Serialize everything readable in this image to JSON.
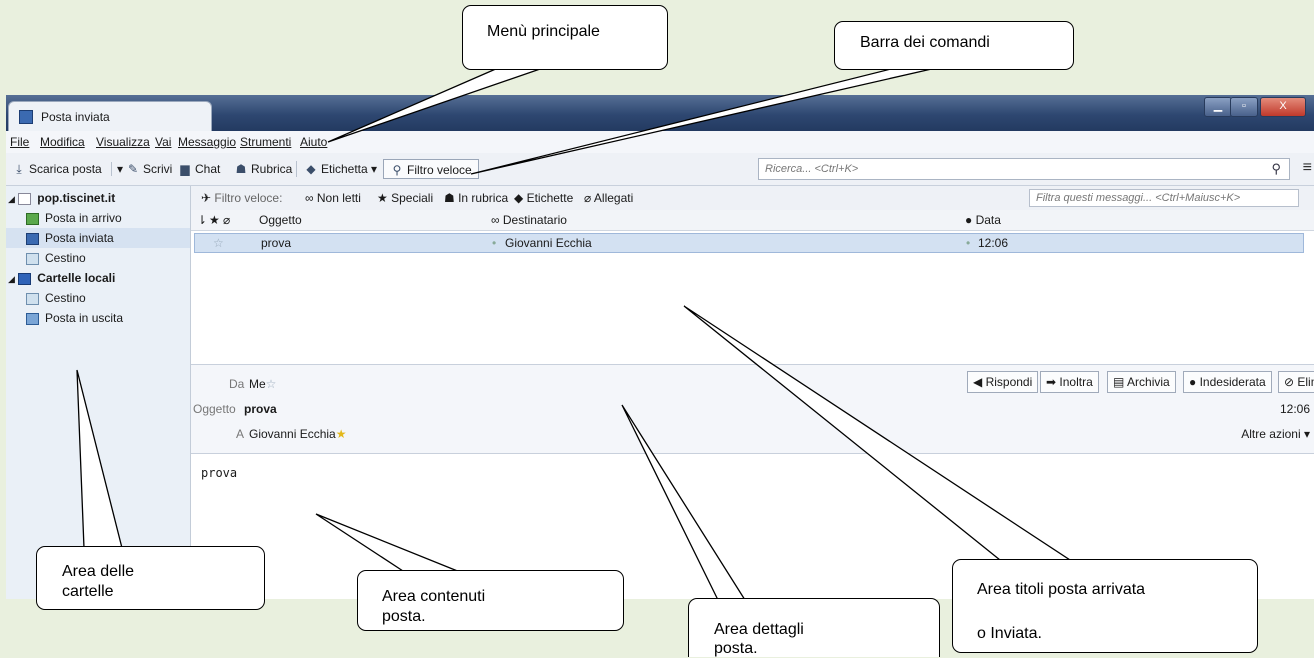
{
  "window": {
    "tab_title": "Posta inviata",
    "controls": {
      "minimize": "▁",
      "maximize": "▫",
      "close": "X"
    }
  },
  "menubar": [
    {
      "label": "File"
    },
    {
      "label": "Modifica"
    },
    {
      "label": "Visualizza"
    },
    {
      "label": "Vai"
    },
    {
      "label": "Messaggio"
    },
    {
      "label": "Strumenti"
    },
    {
      "label": "Aiuto"
    }
  ],
  "toolbar": {
    "download": "Scarica posta",
    "write": "Scrivi",
    "chat": "Chat",
    "addressbook": "Rubrica",
    "tag": "Etichetta",
    "quickfilter": "Filtro veloce",
    "search_placeholder": "Ricerca... <Ctrl+K>"
  },
  "sidebar": {
    "account": "pop.tiscinet.it",
    "items": [
      "Posta in arrivo",
      "Posta inviata",
      "Cestino"
    ],
    "local_folders": "Cartelle locali",
    "local_items": [
      "Cestino",
      "Posta in uscita"
    ]
  },
  "quickfilter": {
    "label": "Filtro veloce:",
    "unread": "Non letti",
    "starred": "Speciali",
    "contact": "In rubrica",
    "tags": "Etichette",
    "attachments": "Allegati",
    "placeholder": "Filtra questi messaggi... <Ctrl+Maiusc+K>"
  },
  "columns": {
    "subject": "Oggetto",
    "recipient": "Destinatario",
    "date": "Data"
  },
  "messages": [
    {
      "subject": "prova",
      "recipient": "Giovanni Ecchia",
      "date": "12:06"
    }
  ],
  "header": {
    "from_label": "Da",
    "from": "Me",
    "subject_label": "Oggetto",
    "subject": "prova",
    "to_label": "A",
    "to": "Giovanni Ecchia",
    "time": "12:06",
    "more": "Altre azioni",
    "actions": [
      "Rispondi",
      "Inoltra",
      "Archivia",
      "Indesiderata",
      "Elimina"
    ]
  },
  "body_text": "prova",
  "callouts": {
    "main_menu": "Menù principale",
    "command_bar": "Barra dei comandi",
    "folders_area": [
      "Area delle",
      "cartelle"
    ],
    "content_area": [
      "Area contenuti",
      "posta."
    ],
    "details_area": [
      "Area dettagli",
      "posta."
    ],
    "titles_area": [
      "Area titoli posta arrivata",
      "o Inviata."
    ]
  }
}
